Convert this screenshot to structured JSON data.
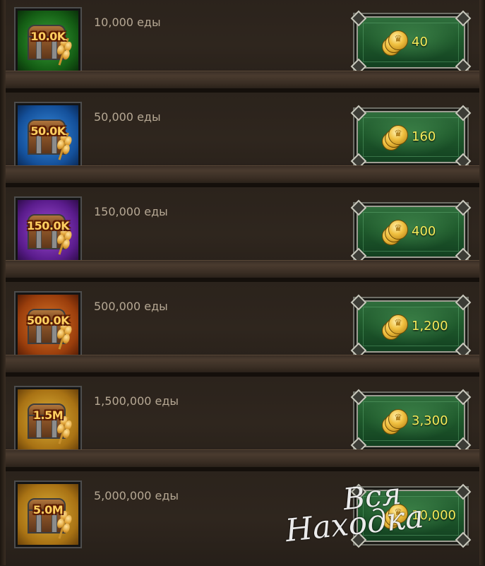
{
  "colors": {
    "food_text": "#b6a894",
    "price_text": "#f6ec5a",
    "amount_text": "#ffcf60",
    "button_green": "#1f5a2c"
  },
  "offers": [
    {
      "amount": "10.0K",
      "description": "10,000 еды",
      "price": "40",
      "tier_color": "green",
      "icon": "chest-wheat-icon",
      "price_icon": "gold-coin-icon"
    },
    {
      "amount": "50.0K",
      "description": "50,000 еды",
      "price": "160",
      "tier_color": "blue",
      "icon": "chest-wheat-icon",
      "price_icon": "gold-coin-icon"
    },
    {
      "amount": "150.0K",
      "description": "150,000 еды",
      "price": "400",
      "tier_color": "purple",
      "icon": "chest-wheat-icon",
      "price_icon": "gold-coin-icon"
    },
    {
      "amount": "500.0K",
      "description": "500,000 еды",
      "price": "1,200",
      "tier_color": "orange",
      "icon": "chest-wheat-icon",
      "price_icon": "gold-coin-icon"
    },
    {
      "amount": "1.5M",
      "description": "1,500,000 еды",
      "price": "3,300",
      "tier_color": "gold",
      "icon": "chest-wheat-icon",
      "price_icon": "gold-coin-icon"
    },
    {
      "amount": "5.0M",
      "description": "5,000,000 еды",
      "price": "10,000",
      "tier_color": "gold",
      "icon": "chest-wheat-icon",
      "price_icon": "gold-coin-icon"
    }
  ],
  "watermark": {
    "line1": "Вся",
    "line2": "Находка"
  }
}
